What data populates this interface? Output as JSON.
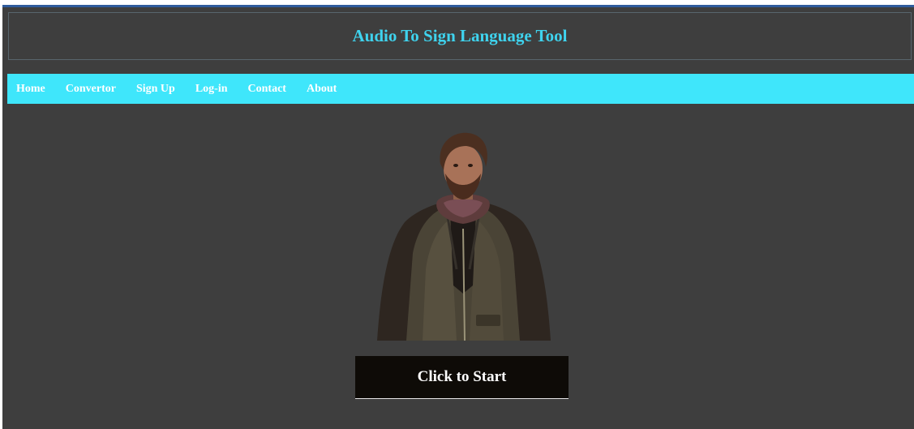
{
  "header": {
    "title": "Audio To Sign Language Tool"
  },
  "nav": {
    "items": [
      {
        "label": "Home"
      },
      {
        "label": "Convertor"
      },
      {
        "label": "Sign Up"
      },
      {
        "label": "Log-in"
      },
      {
        "label": "Contact"
      },
      {
        "label": "About"
      }
    ]
  },
  "main": {
    "start_button_label": "Click to Start"
  },
  "colors": {
    "background": "#3e3e3e",
    "title_accent": "#3fd3ee",
    "nav_background": "#3fe6fb",
    "button_background": "#0e0b07",
    "top_border": "#2f5b9c"
  }
}
